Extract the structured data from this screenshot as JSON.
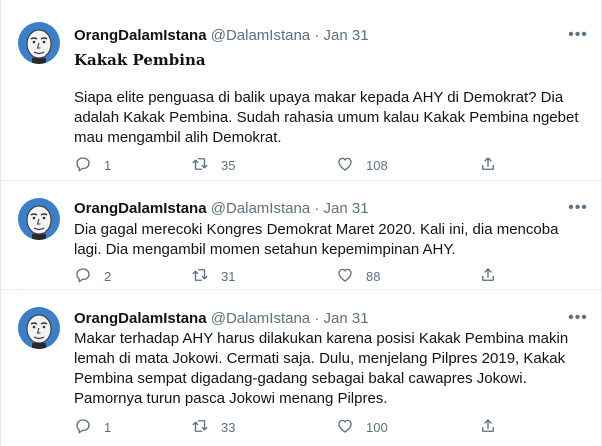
{
  "tweets": [
    {
      "name": "OrangDalamIstana",
      "handle": "@DalamIstana",
      "dot": "·",
      "date": "Jan 31",
      "title": "Kakak Pembina",
      "lines": [
        "Siapa elite penguasa di balik upaya makar kepada AHY di Demokrat? Dia",
        "adalah Kakak Pembina. Sudah rahasia umum kalau Kakak Pembina ngebet",
        "mau mengambil alih Demokrat."
      ],
      "replies": "1",
      "retweets": "35",
      "likes": "108"
    },
    {
      "name": "OrangDalamIstana",
      "handle": "@DalamIstana",
      "dot": "·",
      "date": "Jan 31",
      "lines": [
        "Dia gagal merecoki Kongres Demokrat Maret 2020. Kali ini, dia mencoba",
        "lagi. Dia mengambil momen setahun kepemimpinan AHY."
      ],
      "replies": "2",
      "retweets": "31",
      "likes": "88"
    },
    {
      "name": "OrangDalamIstana",
      "handle": "@DalamIstana",
      "dot": "·",
      "date": "Jan 31",
      "lines": [
        "Makar terhadap AHY harus dilakukan karena posisi Kakak Pembina makin",
        "lemah di mata Jokowi. Cermati saja. Dulu, menjelang Pilpres 2019, Kakak",
        "Pembina sempat digadang-gadang sebagai bakal cawapres Jokowi.",
        "Pamornya turun pasca Jokowi menang Pilpres."
      ],
      "replies": "1",
      "retweets": "33",
      "likes": "100"
    }
  ],
  "icons": {
    "reply": "reply-icon",
    "retweet": "retweet-icon",
    "like": "heart-icon",
    "share": "share-icon",
    "more": "more-icon",
    "avatar": "avatar-bald-head"
  },
  "colors": {
    "text": "#0f1419",
    "secondary": "#5b7083",
    "separator": "#e6ecf0",
    "avatar_bg": "#3c7fc9"
  }
}
